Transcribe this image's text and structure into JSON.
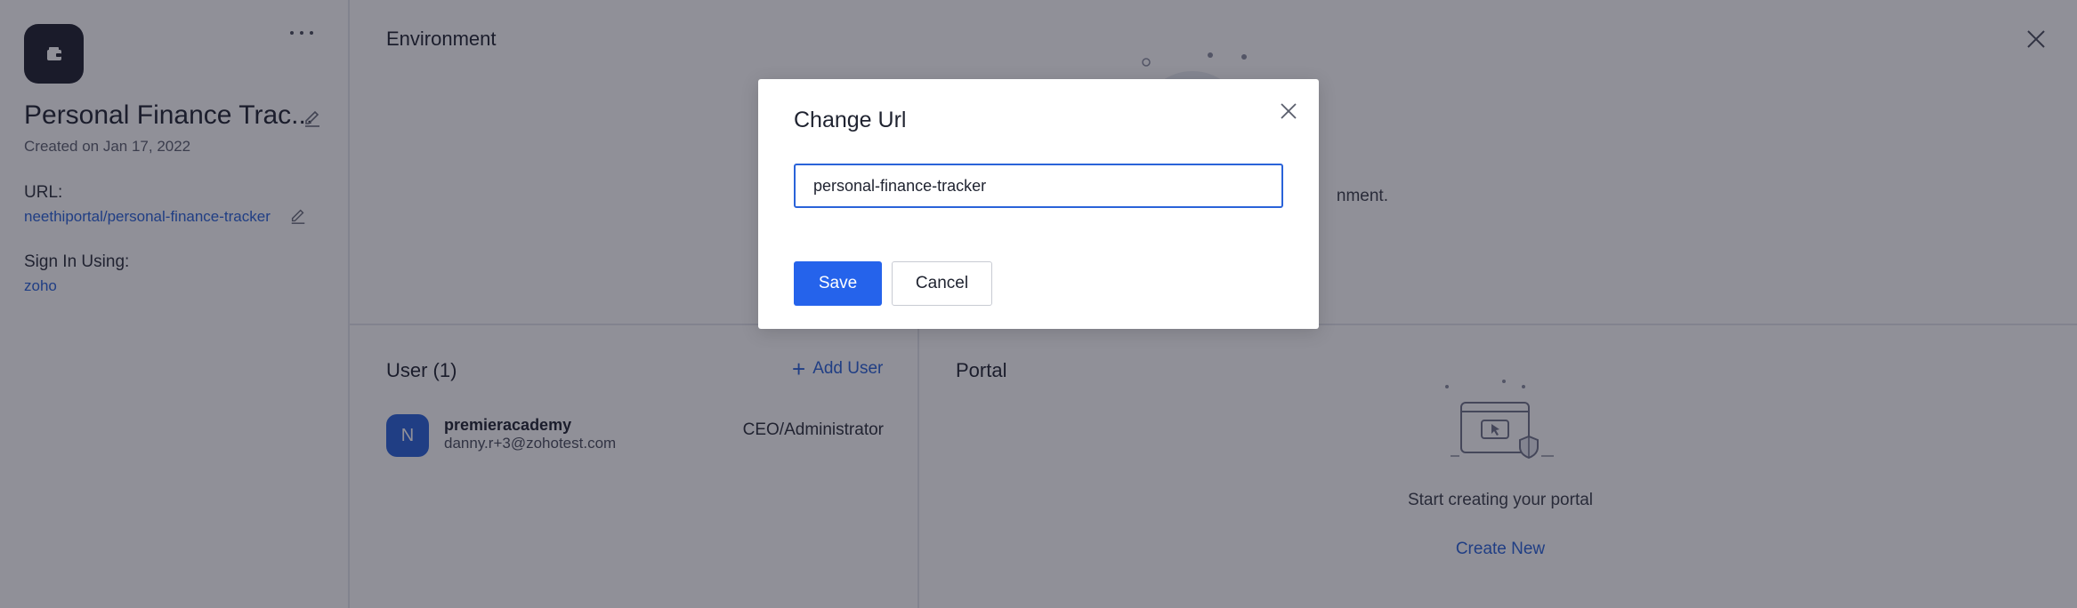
{
  "sidebar": {
    "app_name": "Personal Finance Trac...",
    "created": "Created on Jan 17, 2022",
    "url_label": "URL:",
    "url_value": "neethiportal/personal-finance-tracker",
    "signin_label": "Sign In Using:",
    "signin_value": "zoho",
    "more_icon": "more-horizontal-icon"
  },
  "environment": {
    "title": "Environment",
    "description_fragment": "nment."
  },
  "users": {
    "title": "User (1)",
    "add_label": "Add User",
    "list": [
      {
        "initial": "N",
        "name": "premieracademy",
        "email": "danny.r+3@zohotest.com",
        "role": "CEO/Administrator"
      }
    ]
  },
  "portal": {
    "title": "Portal",
    "empty_text": "Start creating your portal",
    "create_label": "Create New"
  },
  "modal": {
    "title": "Change Url",
    "input_value": "personal-finance-tracker",
    "save_label": "Save",
    "cancel_label": "Cancel"
  },
  "colors": {
    "accent": "#2563eb",
    "link": "#2a63d9",
    "app_icon_bg": "#1d1f2c",
    "overlay": "rgba(22,24,40,0.48)"
  }
}
